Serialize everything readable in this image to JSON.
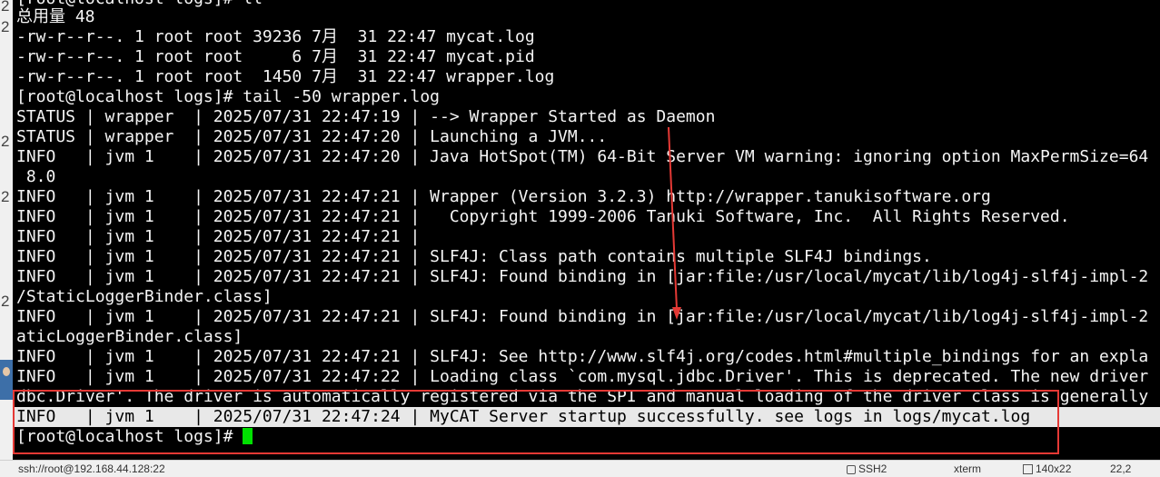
{
  "gutter": {
    "digits": [
      "2",
      "2",
      "2",
      "2",
      "2"
    ]
  },
  "terminal": {
    "lines": [
      "[root@localhost logs]# ll",
      "总用量 48",
      "-rw-r--r--. 1 root root 39236 7月  31 22:47 mycat.log",
      "-rw-r--r--. 1 root root     6 7月  31 22:47 mycat.pid",
      "-rw-r--r--. 1 root root  1450 7月  31 22:47 wrapper.log",
      "[root@localhost logs]# tail -50 wrapper.log",
      "STATUS | wrapper  | 2025/07/31 22:47:19 | --> Wrapper Started as Daemon",
      "STATUS | wrapper  | 2025/07/31 22:47:20 | Launching a JVM...",
      "INFO   | jvm 1    | 2025/07/31 22:47:20 | Java HotSpot(TM) 64-Bit Server VM warning: ignoring option MaxPermSize=64",
      " 8.0",
      "INFO   | jvm 1    | 2025/07/31 22:47:21 | Wrapper (Version 3.2.3) http://wrapper.tanukisoftware.org",
      "INFO   | jvm 1    | 2025/07/31 22:47:21 |   Copyright 1999-2006 Tanuki Software, Inc.  All Rights Reserved.",
      "INFO   | jvm 1    | 2025/07/31 22:47:21 |",
      "INFO   | jvm 1    | 2025/07/31 22:47:21 | SLF4J: Class path contains multiple SLF4J bindings.",
      "INFO   | jvm 1    | 2025/07/31 22:47:21 | SLF4J: Found binding in [jar:file:/usr/local/mycat/lib/log4j-slf4j-impl-2",
      "/StaticLoggerBinder.class]",
      "INFO   | jvm 1    | 2025/07/31 22:47:21 | SLF4J: Found binding in [jar:file:/usr/local/mycat/lib/log4j-slf4j-impl-2",
      "aticLoggerBinder.class]",
      "INFO   | jvm 1    | 2025/07/31 22:47:21 | SLF4J: See http://www.slf4j.org/codes.html#multiple_bindings for an expla",
      "INFO   | jvm 1    | 2025/07/31 22:47:22 | Loading class `com.mysql.jdbc.Driver'. This is deprecated. The new driver",
      "dbc.Driver'. The driver is automatically registered via the SPI and manual loading of the driver class is generally",
      "INFO   | jvm 1    | 2025/07/31 22:47:24 | MyCAT Server startup successfully. see logs in logs/mycat.log"
    ],
    "prompt": "[root@localhost logs]# "
  },
  "statusbar": {
    "connection": "ssh://root@192.168.44.128:22",
    "protocol": "SSH2",
    "term": "xterm",
    "size": "140x22",
    "position": "22,2"
  },
  "colors": {
    "cursor": "#00e000",
    "annotation": "#e53935"
  }
}
